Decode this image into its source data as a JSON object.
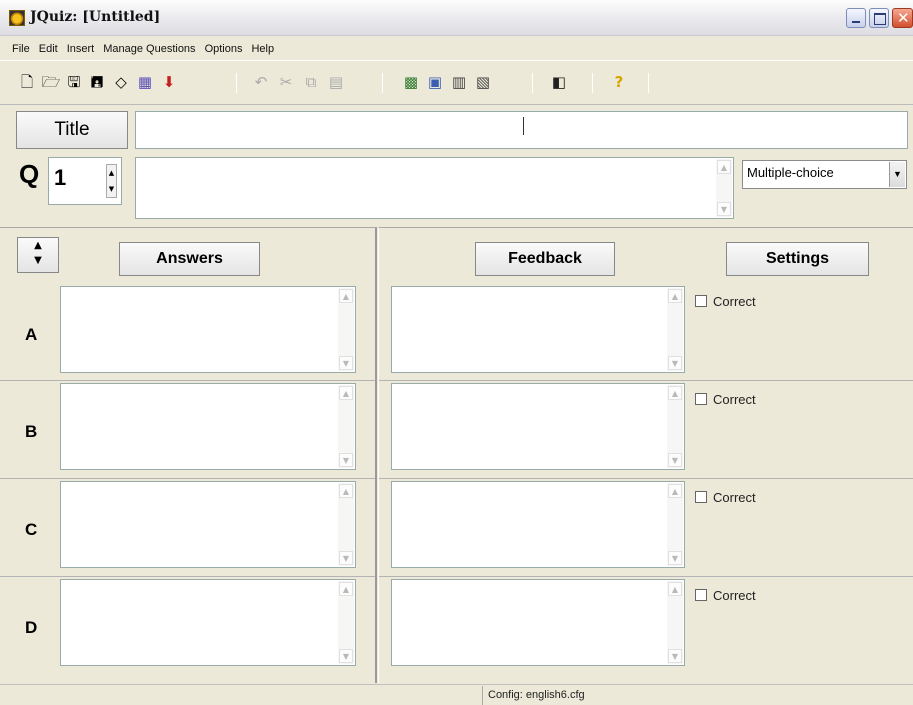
{
  "window": {
    "title": "JQuiz: [Untitled]"
  },
  "menu": [
    "File",
    "Edit",
    "Insert",
    "Manage Questions",
    "Options",
    "Help"
  ],
  "toolbar": {
    "icons": [
      "new-file-icon",
      "open-folder-icon",
      "save-icon",
      "save-as-icon",
      "eraser-icon",
      "web-export-icon",
      "export-arrow-icon",
      "undo-icon",
      "cut-icon",
      "copy-icon",
      "paste-icon",
      "insert-picture-icon",
      "insert-link-icon",
      "insert-media-icon",
      "insert-object-icon",
      "config-icon",
      "help-icon"
    ]
  },
  "header": {
    "title_button": "Title",
    "title_value": "",
    "q_label": "Q",
    "question_number": "1",
    "question_text": "",
    "question_type": "Multiple-choice"
  },
  "answers_section": {
    "answers_header": "Answers",
    "feedback_header": "Feedback",
    "settings_header": "Settings",
    "rows": [
      {
        "letter": "A",
        "answer": "",
        "feedback": "",
        "correct_label": "Correct",
        "correct": false
      },
      {
        "letter": "B",
        "answer": "",
        "feedback": "",
        "correct_label": "Correct",
        "correct": false
      },
      {
        "letter": "C",
        "answer": "",
        "feedback": "",
        "correct_label": "Correct",
        "correct": false
      },
      {
        "letter": "D",
        "answer": "",
        "feedback": "",
        "correct_label": "Correct",
        "correct": false
      }
    ]
  },
  "status": {
    "config": "Config: english6.cfg"
  }
}
